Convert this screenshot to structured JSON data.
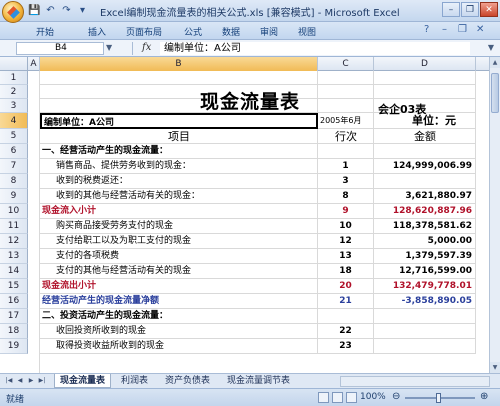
{
  "window": {
    "title": "Excel编制现金流量表的相关公式.xls [兼容模式] - Microsoft Excel",
    "qat": [
      "💾",
      "↶",
      "↷",
      "▾"
    ],
    "controls": {
      "minimize": "–",
      "restore": "❐",
      "close": "✕"
    }
  },
  "ribbon": {
    "tabs": [
      "开始",
      "插入",
      "页面布局",
      "公式",
      "数据",
      "审阅",
      "视图"
    ],
    "right_icons": [
      "?",
      "–",
      "❐",
      "✕"
    ]
  },
  "formula_bar": {
    "name_box": "B4",
    "fx": "fx",
    "content": "编制单位：A公司"
  },
  "columns": [
    "A",
    "B",
    "C",
    "D"
  ],
  "selected_column": "B",
  "selected_row": "4",
  "sheet": {
    "title": "现金流量表",
    "form_no": "会企03表",
    "unit_label": "单位：元",
    "company": "编制单位：A公司",
    "date": "2005年6月",
    "headers": {
      "item": "项目",
      "row": "行次",
      "amount": "金额"
    },
    "rows": [
      {
        "n": "1",
        "b": "",
        "c": "",
        "d": "",
        "style": ""
      },
      {
        "n": "2",
        "b": "",
        "c": "",
        "d": "",
        "style": ""
      },
      {
        "n": "3",
        "b": "",
        "c": "",
        "d": "",
        "style": ""
      },
      {
        "n": "4",
        "b": "",
        "c": "",
        "d": "",
        "style": ""
      },
      {
        "n": "5",
        "b": "",
        "c": "",
        "d": "",
        "style": ""
      },
      {
        "n": "6",
        "b": "一、经营活动产生的现金流量：",
        "c": "",
        "d": "",
        "style": "bold"
      },
      {
        "n": "7",
        "b": "销售商品、提供劳务收到的现金：",
        "c": "1",
        "d": "124,999,006.99",
        "style": "indent"
      },
      {
        "n": "8",
        "b": "收到的税费返还：",
        "c": "3",
        "d": "",
        "style": "indent"
      },
      {
        "n": "9",
        "b": "收到的其他与经营活动有关的现金：",
        "c": "8",
        "d": "3,621,880.97",
        "style": "indent"
      },
      {
        "n": "10",
        "b": "现金流入小计",
        "c": "9",
        "d": "128,620,887.96",
        "style": "red"
      },
      {
        "n": "11",
        "b": "购买商品接受劳务支付的现金",
        "c": "10",
        "d": "118,378,581.62",
        "style": "indent"
      },
      {
        "n": "12",
        "b": "支付给职工以及为职工支付的现金",
        "c": "12",
        "d": "5,000.00",
        "style": "indent"
      },
      {
        "n": "13",
        "b": "支付的各项税费",
        "c": "13",
        "d": "1,379,597.39",
        "style": "indent"
      },
      {
        "n": "14",
        "b": "支付的其他与经营活动有关的现金",
        "c": "18",
        "d": "12,716,599.00",
        "style": "indent"
      },
      {
        "n": "15",
        "b": "现金流出小计",
        "c": "20",
        "d": "132,479,778.01",
        "style": "red"
      },
      {
        "n": "16",
        "b": "经营活动产生的现金流量净额",
        "c": "21",
        "d": "-3,858,890.05",
        "style": "blue"
      },
      {
        "n": "17",
        "b": "二、投资活动产生的现金流量：",
        "c": "",
        "d": "",
        "style": "bold"
      },
      {
        "n": "18",
        "b": "收回投资所收到的现金",
        "c": "22",
        "d": "",
        "style": "indent"
      },
      {
        "n": "19",
        "b": "取得投资收益所收到的现金",
        "c": "23",
        "d": "",
        "style": "indent"
      }
    ]
  },
  "sheet_tabs": {
    "tabs": [
      "现金流量表",
      "利润表",
      "资产负债表",
      "现金流量调节表"
    ],
    "active": 0
  },
  "status": {
    "text": "就绪",
    "zoom": "100%",
    "zoom_level_percent": 100
  }
}
